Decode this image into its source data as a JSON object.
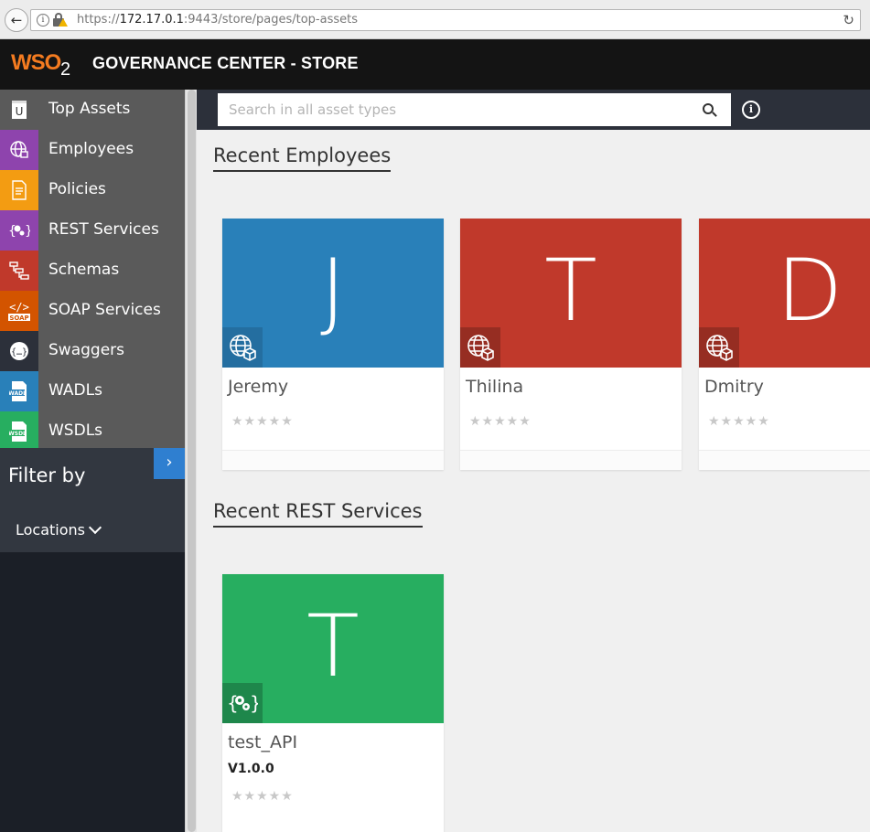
{
  "browser": {
    "url_scheme": "https://",
    "url_host": "172.17.0.1",
    "url_rest": ":9443/store/pages/top-assets"
  },
  "header": {
    "logo_text": "WSO",
    "logo_sub": "2",
    "title": "GOVERNANCE CENTER - STORE"
  },
  "sidebar": {
    "items": [
      {
        "label": "Top Assets",
        "icon": "top-assets-icon",
        "color": "#5a5a5a"
      },
      {
        "label": "Employees",
        "icon": "globe-icon",
        "color": "#8e44ad"
      },
      {
        "label": "Policies",
        "icon": "document-icon",
        "color": "#f39c12"
      },
      {
        "label": "REST Services",
        "icon": "gears-icon",
        "color": "#8e44ad"
      },
      {
        "label": "Schemas",
        "icon": "schema-tree-icon",
        "color": "#c0392b"
      },
      {
        "label": "SOAP Services",
        "icon": "soap-icon",
        "color": "#d35400"
      },
      {
        "label": "Swaggers",
        "icon": "swagger-icon",
        "color": "#2c303a"
      },
      {
        "label": "WADLs",
        "icon": "wadl-file-icon",
        "color": "#2980b9"
      },
      {
        "label": "WSDLs",
        "icon": "wsdl-file-icon",
        "color": "#27ae60"
      }
    ],
    "filter_title": "Filter by",
    "filter_locations": "Locations"
  },
  "search": {
    "placeholder": "Search in all asset types"
  },
  "sections": {
    "employees_title": "Recent Employees",
    "rest_title": "Recent REST Services"
  },
  "employees": [
    {
      "letter": "J",
      "name": "Jeremy",
      "color": "#2980b9",
      "badge": "#246ea0"
    },
    {
      "letter": "T",
      "name": "Thilina",
      "color": "#c0392b",
      "badge": "#962d22"
    },
    {
      "letter": "D",
      "name": "Dmitry",
      "color": "#c0392b",
      "badge": "#962d22"
    }
  ],
  "rest_services": [
    {
      "letter": "T",
      "name": "test_API",
      "version": "V1.0.0",
      "color": "#27ae60",
      "badge": "#1e874b"
    }
  ],
  "stars": "★★★★★"
}
